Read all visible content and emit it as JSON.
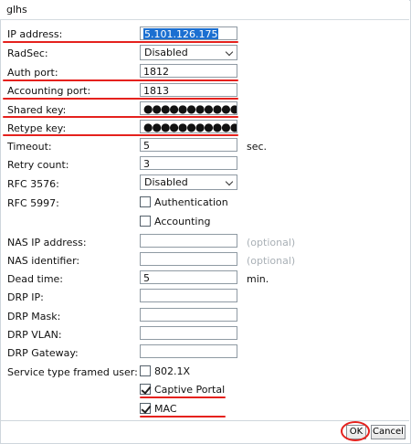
{
  "window": {
    "title": "glhs"
  },
  "fields": {
    "ip_address": {
      "label": "IP address:",
      "value": "5.101.126.175"
    },
    "radsec": {
      "label": "RadSec:",
      "value": "Disabled"
    },
    "auth_port": {
      "label": "Auth port:",
      "value": "1812"
    },
    "accounting_port": {
      "label": "Accounting port:",
      "value": "1813"
    },
    "shared_key": {
      "label": "Shared key:",
      "value": "●●●●●●●●●●●●●●●●"
    },
    "retype_key": {
      "label": "Retype key:",
      "value": "●●●●●●●●●●●●●●●●"
    },
    "timeout": {
      "label": "Timeout:",
      "value": "5",
      "unit": "sec."
    },
    "retry_count": {
      "label": "Retry count:",
      "value": "3"
    },
    "rfc3576": {
      "label": "RFC 3576:",
      "value": "Disabled"
    },
    "rfc5997": {
      "label": "RFC 5997:",
      "options": [
        {
          "label": "Authentication",
          "checked": false
        },
        {
          "label": "Accounting",
          "checked": false
        }
      ]
    },
    "nas_ip": {
      "label": "NAS IP address:",
      "value": "",
      "hint": "(optional)"
    },
    "nas_identifier": {
      "label": "NAS identifier:",
      "value": "",
      "hint": "(optional)"
    },
    "dead_time": {
      "label": "Dead time:",
      "value": "5",
      "unit": "min."
    },
    "drp_ip": {
      "label": "DRP IP:",
      "value": ""
    },
    "drp_mask": {
      "label": "DRP Mask:",
      "value": ""
    },
    "drp_vlan": {
      "label": "DRP VLAN:",
      "value": ""
    },
    "drp_gateway": {
      "label": "DRP Gateway:",
      "value": ""
    },
    "service_type": {
      "label": "Service type framed user:",
      "options": [
        {
          "label": "802.1X",
          "checked": false
        },
        {
          "label": "Captive Portal",
          "checked": true
        },
        {
          "label": "MAC",
          "checked": true
        }
      ]
    }
  },
  "buttons": {
    "ok": "OK",
    "cancel": "Cancel"
  },
  "colors": {
    "annotation_red": "#e5211d",
    "selection_blue": "#1b6fd1"
  }
}
